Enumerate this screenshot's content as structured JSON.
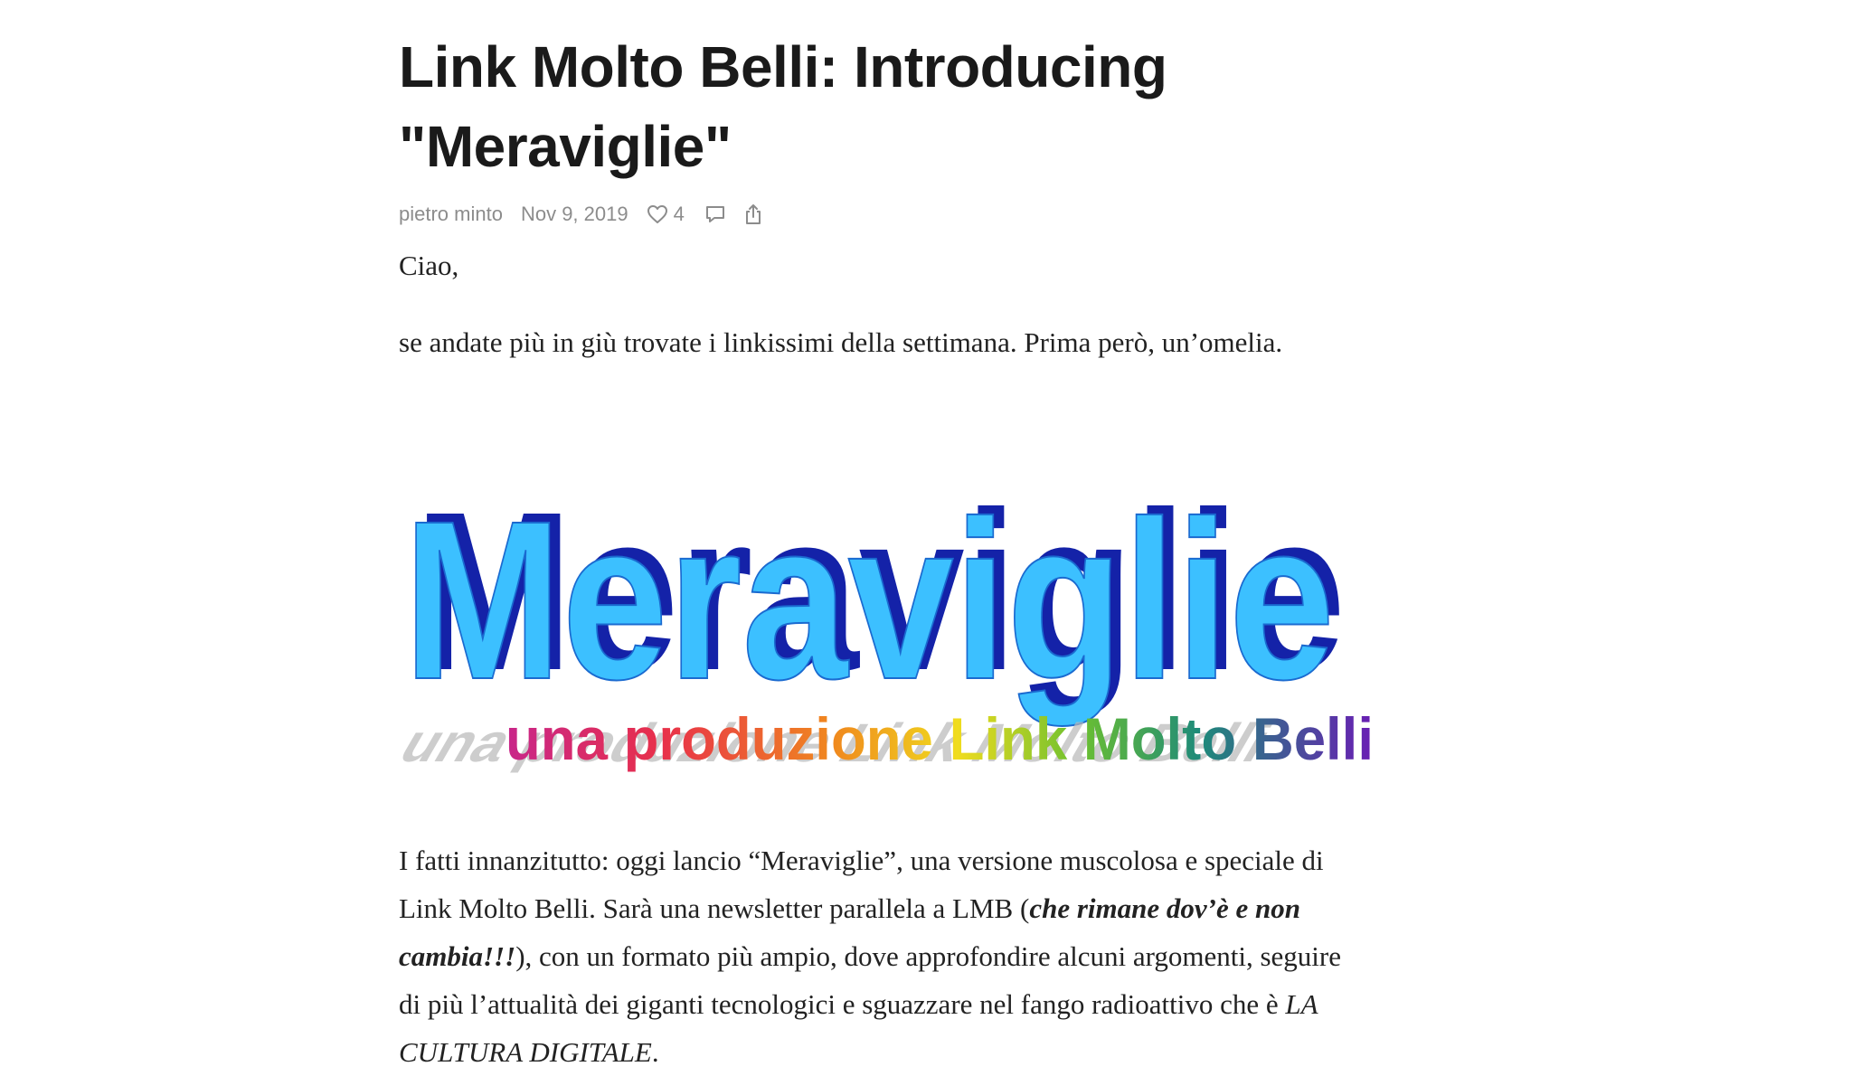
{
  "post": {
    "title_line1": "Link Molto Belli: Introducing",
    "title_line2": "\"Meraviglie\"",
    "author": "pietro minto",
    "date": "Nov 9, 2019",
    "likes": "4",
    "like_icon": "heart-icon",
    "comment_icon": "comment-icon",
    "share_icon": "share-icon"
  },
  "content": {
    "greeting": "Ciao,",
    "intro": "se andate più in giù trovate i linkissimi della settimana. Prima però, un’omelia.",
    "banner": {
      "title": "Meraviglie",
      "subtitle_parts": [
        "una",
        " ",
        "produzione",
        " ",
        "Link",
        " ",
        "Molto",
        " ",
        "Belli"
      ],
      "title_color": "#3cc0ff",
      "shadow_color": "#1422a8"
    },
    "main": {
      "l1": "I fatti innanzitutto: oggi lancio “Meraviglie”, una versione muscolosa e speciale di",
      "l2_a": "Link Molto Belli. Sarà una newsletter parallela a LMB (",
      "l2_b": "che rimane dov’è e non",
      "l3_a": "cambia!!!",
      "l3_b": "), con un formato più ampio, dove approfondire alcuni argomenti, seguire",
      "l4_a": "di più l’attualità dei giganti tecnologici e sguazzare nel fango radioattivo che è ",
      "l4_b": "LA",
      "l5_a": "CULTURA DIGITALE",
      "l5_b": "."
    }
  }
}
